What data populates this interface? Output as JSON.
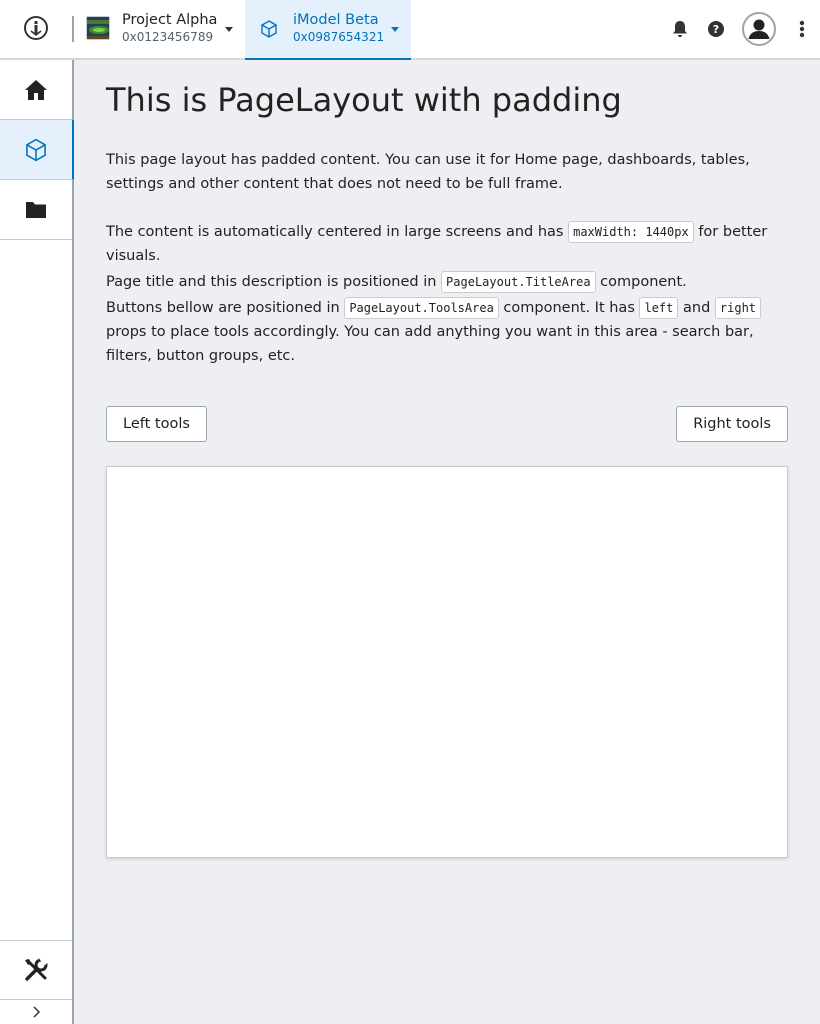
{
  "header": {
    "project": {
      "title": "Project Alpha",
      "id": "0x0123456789"
    },
    "imodel": {
      "title": "iModel Beta",
      "id": "0x0987654321"
    }
  },
  "icons": {
    "logo": "bentley-logo-icon",
    "notifications": "bell-icon",
    "help": "help-icon",
    "avatar": "user-icon",
    "more": "more-vertical-icon",
    "nav_home": "home-icon",
    "nav_model": "cube-icon",
    "nav_folder": "folder-icon",
    "nav_tools": "tools-icon",
    "nav_expand": "chevron-right-icon"
  },
  "colors": {
    "accent": "#0073ba",
    "background": "#edeff2"
  },
  "content": {
    "title": "This is PageLayout with padding",
    "p1": "This page layout has padded content. You can use it for Home page, dashboards, tables, settings and other content that does not need to be full frame.",
    "p2_a": "The content is automatically centered in large screens and has",
    "p2_code": "maxWidth: 1440px",
    "p2_b": "for better visuals.",
    "p3_a": "Page title and this description is positioned in",
    "p3_code": "PageLayout.TitleArea",
    "p3_b": "component.",
    "p4_a": "Buttons bellow are positioned in",
    "p4_code1": "PageLayout.ToolsArea",
    "p4_b": "component. It has",
    "p4_code2": "left",
    "p4_c": "and",
    "p4_code3": "right",
    "p4_d": "props to place tools accordingly. You can add anything you want in this area - search bar, filters, button groups, etc.",
    "left_button": "Left tools",
    "right_button": "Right tools"
  }
}
